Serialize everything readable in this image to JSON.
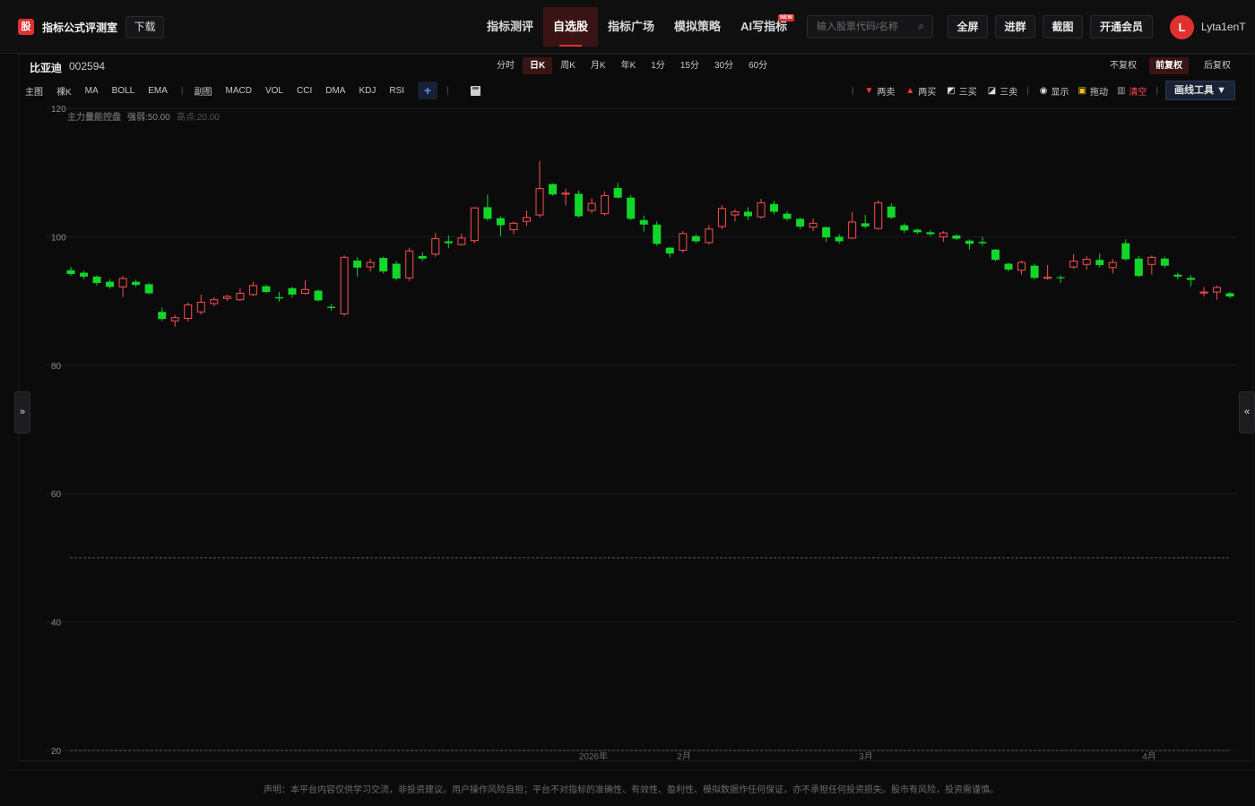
{
  "app": {
    "logo_glyph": "股",
    "title": "指标公式评测室",
    "download_label": "下载"
  },
  "nav": {
    "items": [
      {
        "label": "指标测评"
      },
      {
        "label": "自选股"
      },
      {
        "label": "指标广场"
      },
      {
        "label": "模拟策略"
      },
      {
        "label": "AI写指标"
      }
    ],
    "new_badge": "NEW"
  },
  "search": {
    "placeholder": "输入股票代码/名称"
  },
  "toolbar": {
    "fullscreen": "全屏",
    "join_group": "进群",
    "screenshot": "截图",
    "membership": "开通会员"
  },
  "user": {
    "avatar_initial": "L",
    "name": "Lyta1enT"
  },
  "stock": {
    "name": "比亚迪",
    "code": "002594"
  },
  "periods": [
    "分时",
    "日K",
    "周K",
    "月K",
    "年K",
    "1分",
    "15分",
    "30分",
    "60分"
  ],
  "adjust": [
    "不复权",
    "前复权",
    "后复权"
  ],
  "indicators": {
    "main_label": "主图",
    "main": [
      "裸K",
      "MA",
      "BOLL",
      "EMA"
    ],
    "sub_label": "副图",
    "sub": [
      "MACD",
      "VOL",
      "CCI",
      "DMA",
      "KDJ",
      "RSI"
    ],
    "add_glyph": "+"
  },
  "draw_tools": {
    "sell2": "两卖",
    "buy2": "两买",
    "buy3": "三买",
    "sell3": "三卖",
    "show": "显示",
    "drag": "拖动",
    "clear": "清空",
    "menu": "画线工具 ▼"
  },
  "side": {
    "left_glyph": "»",
    "right_glyph": "«"
  },
  "chart_data": {
    "type": "candlestick",
    "legend": {
      "name": "主力量能控盘",
      "strong_label": "强弱:50.00",
      "high_label": "高点:20.00"
    },
    "ylim": [
      20,
      120
    ],
    "yticks": [
      120,
      100,
      80,
      60,
      40,
      20
    ],
    "reference_lines": [
      50,
      20
    ],
    "x_labels": [
      "2026年",
      "2月",
      "3月",
      "4月"
    ],
    "colors": {
      "up": "#ff4d4f",
      "down": "#13d62a",
      "grid": "#1e1e20",
      "ref": "#5a5a5a"
    },
    "candles": [
      {
        "o": 94.8,
        "c": 94.2,
        "h": 95.3,
        "l": 93.9
      },
      {
        "o": 94.4,
        "c": 93.8,
        "h": 94.7,
        "l": 93.4
      },
      {
        "o": 93.8,
        "c": 92.8,
        "h": 94.0,
        "l": 92.4
      },
      {
        "o": 93.0,
        "c": 92.2,
        "h": 93.4,
        "l": 91.9
      },
      {
        "o": 92.2,
        "c": 93.5,
        "h": 93.9,
        "l": 90.6
      },
      {
        "o": 93.0,
        "c": 92.5,
        "h": 93.3,
        "l": 92.2
      },
      {
        "o": 92.6,
        "c": 91.2,
        "h": 92.8,
        "l": 91.0
      },
      {
        "o": 88.3,
        "c": 87.2,
        "h": 89.0,
        "l": 86.9
      },
      {
        "o": 86.9,
        "c": 87.4,
        "h": 87.8,
        "l": 86.0
      },
      {
        "o": 87.3,
        "c": 89.4,
        "h": 89.8,
        "l": 86.8
      },
      {
        "o": 88.3,
        "c": 89.8,
        "h": 91.0,
        "l": 87.9
      },
      {
        "o": 89.6,
        "c": 90.2,
        "h": 90.6,
        "l": 89.2
      },
      {
        "o": 90.4,
        "c": 90.7,
        "h": 91.0,
        "l": 90.0
      },
      {
        "o": 90.2,
        "c": 91.2,
        "h": 92.0,
        "l": 90.0
      },
      {
        "o": 91.0,
        "c": 92.4,
        "h": 93.0,
        "l": 90.8
      },
      {
        "o": 92.3,
        "c": 91.4,
        "h": 92.5,
        "l": 91.2
      },
      {
        "o": 90.6,
        "c": 90.4,
        "h": 91.4,
        "l": 89.9
      },
      {
        "o": 92.0,
        "c": 91.0,
        "h": 92.2,
        "l": 90.5
      },
      {
        "o": 91.2,
        "c": 91.8,
        "h": 93.2,
        "l": 91.0
      },
      {
        "o": 91.6,
        "c": 90.1,
        "h": 91.8,
        "l": 89.9
      },
      {
        "o": 89.1,
        "c": 88.9,
        "h": 89.5,
        "l": 88.5
      },
      {
        "o": 88.0,
        "c": 96.8,
        "h": 97.1,
        "l": 87.7
      },
      {
        "o": 96.3,
        "c": 95.2,
        "h": 96.8,
        "l": 93.8
      },
      {
        "o": 95.3,
        "c": 96.0,
        "h": 96.6,
        "l": 94.6
      },
      {
        "o": 96.7,
        "c": 94.6,
        "h": 96.9,
        "l": 94.3
      },
      {
        "o": 95.8,
        "c": 93.5,
        "h": 96.2,
        "l": 93.2
      },
      {
        "o": 93.6,
        "c": 97.8,
        "h": 98.3,
        "l": 93.1
      },
      {
        "o": 97.0,
        "c": 96.6,
        "h": 97.6,
        "l": 96.2
      },
      {
        "o": 97.3,
        "c": 99.7,
        "h": 100.6,
        "l": 96.9
      },
      {
        "o": 99.3,
        "c": 99.0,
        "h": 100.2,
        "l": 98.2
      },
      {
        "o": 98.8,
        "c": 99.8,
        "h": 100.5,
        "l": 98.6
      },
      {
        "o": 99.4,
        "c": 104.5,
        "h": 104.6,
        "l": 99.0
      },
      {
        "o": 104.6,
        "c": 102.8,
        "h": 106.6,
        "l": 102.5
      },
      {
        "o": 102.9,
        "c": 101.8,
        "h": 103.2,
        "l": 100.1
      },
      {
        "o": 101.1,
        "c": 102.1,
        "h": 102.4,
        "l": 100.4
      },
      {
        "o": 102.4,
        "c": 103.0,
        "h": 104.1,
        "l": 101.7
      },
      {
        "o": 103.4,
        "c": 107.5,
        "h": 111.8,
        "l": 103.0
      },
      {
        "o": 108.2,
        "c": 106.6,
        "h": 108.3,
        "l": 106.4
      },
      {
        "o": 106.8,
        "c": 106.8,
        "h": 107.5,
        "l": 104.9
      },
      {
        "o": 106.7,
        "c": 103.2,
        "h": 107.2,
        "l": 103.0
      },
      {
        "o": 104.1,
        "c": 105.2,
        "h": 106.0,
        "l": 103.7
      },
      {
        "o": 103.6,
        "c": 106.4,
        "h": 107.1,
        "l": 103.3
      },
      {
        "o": 107.6,
        "c": 106.1,
        "h": 108.4,
        "l": 106.0
      },
      {
        "o": 106.1,
        "c": 102.8,
        "h": 106.5,
        "l": 102.6
      },
      {
        "o": 102.6,
        "c": 101.9,
        "h": 103.3,
        "l": 100.8
      },
      {
        "o": 101.9,
        "c": 98.9,
        "h": 102.4,
        "l": 98.6
      },
      {
        "o": 98.3,
        "c": 97.4,
        "h": 98.4,
        "l": 96.8
      },
      {
        "o": 97.9,
        "c": 100.5,
        "h": 100.9,
        "l": 97.5
      },
      {
        "o": 100.1,
        "c": 99.3,
        "h": 100.4,
        "l": 99.0
      },
      {
        "o": 99.1,
        "c": 101.2,
        "h": 101.8,
        "l": 98.8
      },
      {
        "o": 101.6,
        "c": 104.4,
        "h": 104.9,
        "l": 101.2
      },
      {
        "o": 103.4,
        "c": 103.9,
        "h": 104.3,
        "l": 102.4
      },
      {
        "o": 103.9,
        "c": 103.2,
        "h": 104.6,
        "l": 102.6
      },
      {
        "o": 103.1,
        "c": 105.3,
        "h": 105.9,
        "l": 102.8
      },
      {
        "o": 105.1,
        "c": 103.9,
        "h": 105.6,
        "l": 103.5
      },
      {
        "o": 103.6,
        "c": 102.8,
        "h": 104.0,
        "l": 102.5
      },
      {
        "o": 102.8,
        "c": 101.6,
        "h": 103.0,
        "l": 101.2
      },
      {
        "o": 101.5,
        "c": 102.1,
        "h": 102.8,
        "l": 100.9
      },
      {
        "o": 101.5,
        "c": 99.9,
        "h": 101.6,
        "l": 99.2
      },
      {
        "o": 100.0,
        "c": 99.3,
        "h": 100.4,
        "l": 98.9
      },
      {
        "o": 99.8,
        "c": 102.3,
        "h": 103.9,
        "l": 99.6
      },
      {
        "o": 102.1,
        "c": 101.6,
        "h": 103.4,
        "l": 101.3
      },
      {
        "o": 101.3,
        "c": 105.3,
        "h": 105.7,
        "l": 101.1
      },
      {
        "o": 104.7,
        "c": 103.0,
        "h": 105.2,
        "l": 102.8
      },
      {
        "o": 101.8,
        "c": 101.0,
        "h": 102.1,
        "l": 100.6
      },
      {
        "o": 101.1,
        "c": 100.7,
        "h": 101.3,
        "l": 100.4
      },
      {
        "o": 100.7,
        "c": 100.4,
        "h": 101.0,
        "l": 100.1
      },
      {
        "o": 100.0,
        "c": 100.6,
        "h": 100.9,
        "l": 99.2
      },
      {
        "o": 100.2,
        "c": 99.7,
        "h": 100.4,
        "l": 99.5
      },
      {
        "o": 99.4,
        "c": 98.9,
        "h": 99.6,
        "l": 98.0
      },
      {
        "o": 99.2,
        "c": 99.0,
        "h": 100.0,
        "l": 98.6
      },
      {
        "o": 98.0,
        "c": 96.4,
        "h": 98.1,
        "l": 96.2
      },
      {
        "o": 95.8,
        "c": 94.9,
        "h": 96.0,
        "l": 94.6
      },
      {
        "o": 94.8,
        "c": 96.0,
        "h": 96.3,
        "l": 94.1
      },
      {
        "o": 95.5,
        "c": 93.6,
        "h": 95.8,
        "l": 93.4
      },
      {
        "o": 93.6,
        "c": 93.7,
        "h": 95.6,
        "l": 93.3
      },
      {
        "o": 93.7,
        "c": 93.6,
        "h": 94.0,
        "l": 92.8
      },
      {
        "o": 95.3,
        "c": 96.2,
        "h": 97.3,
        "l": 95.0
      },
      {
        "o": 95.7,
        "c": 96.5,
        "h": 97.0,
        "l": 94.9
      },
      {
        "o": 96.4,
        "c": 95.6,
        "h": 97.4,
        "l": 95.2
      },
      {
        "o": 95.2,
        "c": 96.0,
        "h": 96.5,
        "l": 94.3
      },
      {
        "o": 99.0,
        "c": 96.5,
        "h": 99.6,
        "l": 96.3
      },
      {
        "o": 96.6,
        "c": 93.9,
        "h": 97.0,
        "l": 93.7
      },
      {
        "o": 95.7,
        "c": 96.8,
        "h": 97.1,
        "l": 94.1
      },
      {
        "o": 96.6,
        "c": 95.5,
        "h": 96.9,
        "l": 95.2
      },
      {
        "o": 94.1,
        "c": 93.8,
        "h": 94.4,
        "l": 93.4
      },
      {
        "o": 93.6,
        "c": 93.3,
        "h": 94.0,
        "l": 92.3
      },
      {
        "o": 91.3,
        "c": 91.4,
        "h": 92.2,
        "l": 90.7
      },
      {
        "o": 91.4,
        "c": 92.1,
        "h": 92.4,
        "l": 90.2
      },
      {
        "o": 91.2,
        "c": 90.7,
        "h": 91.4,
        "l": 90.4
      }
    ]
  },
  "footer": {
    "disclaimer": "声明：本平台内容仅供学习交流，非投资建议。用户操作风险自担；平台不对指标的准确性、有效性、盈利性、模拟数据作任何保证，亦不承担任何投资损失。股市有风险，投资需谨慎。"
  }
}
